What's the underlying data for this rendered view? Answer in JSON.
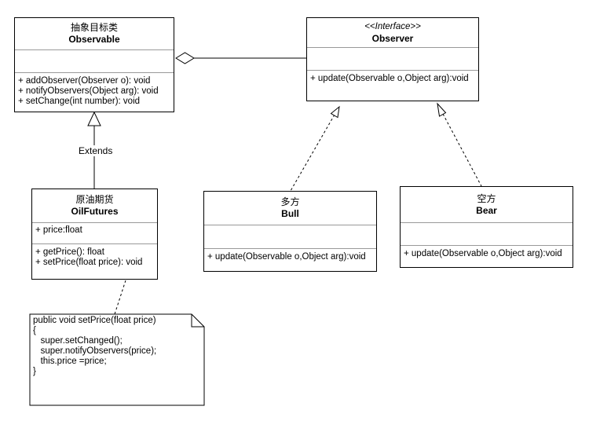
{
  "classes": {
    "observable": {
      "cn_name": "抽象目标类",
      "name": "Observable",
      "operations": [
        "+ addObserver(Observer o): void",
        "+ notifyObservers(Object arg): void",
        "+ setChange(int number): void"
      ]
    },
    "observer": {
      "stereotype": "<<Interface>>",
      "name": "Observer",
      "operations": [
        "+ update(Observable o,Object arg):void"
      ]
    },
    "oilfutures": {
      "cn_name": "原油期货",
      "name": "OilFutures",
      "attributes": [
        "+ price:float"
      ],
      "operations": [
        "+ getPrice(): float",
        "+ setPrice(float price): void"
      ]
    },
    "bull": {
      "cn_name": "多方",
      "name": "Bull",
      "operations": [
        "+ update(Observable o,Object arg):void"
      ]
    },
    "bear": {
      "cn_name": "空方",
      "name": "Bear",
      "operations": [
        "+ update(Observable o,Object arg):void"
      ]
    }
  },
  "relations": {
    "extends_label": "Extends"
  },
  "note": {
    "lines": [
      "public void setPrice(float price)",
      "{",
      "   super.setChanged();",
      "   super.notifyObservers(price);",
      "   this.price =price;",
      "}"
    ]
  }
}
